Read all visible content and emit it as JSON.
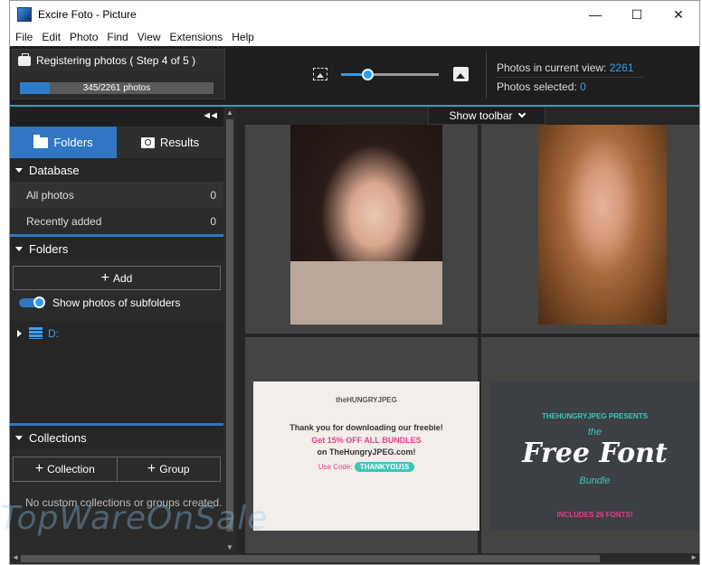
{
  "window": {
    "title": "Excire Foto - Picture",
    "minimize": "—",
    "maximize": "☐",
    "close": "✕"
  },
  "menu": [
    "File",
    "Edit",
    "Photo",
    "Find",
    "View",
    "Extensions",
    "Help"
  ],
  "registration": {
    "label": "Registering photos ( Step 4 of 5 )",
    "progress_text": "345/2261 photos",
    "progress_fraction": 0.1526
  },
  "zoom_slider": {
    "value_fraction": 0.27
  },
  "stats": {
    "in_view_label": "Photos in current view:",
    "in_view_value": "2261",
    "selected_label": "Photos selected:",
    "selected_value": "0"
  },
  "sidebar": {
    "collapse_glyph": "◄◄",
    "tabs": [
      {
        "label": "Folders",
        "active": true
      },
      {
        "label": "Results",
        "active": false
      }
    ],
    "database": {
      "header": "Database",
      "rows": [
        {
          "label": "All photos",
          "count": "0"
        },
        {
          "label": "Recently added",
          "count": "0"
        }
      ]
    },
    "folders": {
      "header": "Folders",
      "add_label": "Add",
      "subfolders_toggle": "Show photos of subfolders",
      "subfolders_on": true,
      "drive": "D:"
    },
    "collections": {
      "header": "Collections",
      "collection_btn": "Collection",
      "group_btn": "Group",
      "empty_note": "No custom collections or groups created."
    }
  },
  "gallery": {
    "toolbar_label": "Show toolbar",
    "promo1": {
      "brand": "theHUNGRYJPEG",
      "line1": "Thank you for downloading our freebie!",
      "line2": "Get 15% OFF ALL BUNDLES",
      "line3": "on TheHungryJPEG.com!",
      "code_label": "Use Code:",
      "code": "THANKYOU15"
    },
    "promo2": {
      "presents": "THEHUNGRYJPEG PRESENTS",
      "the": "the",
      "main": "Free Font",
      "sub": "Bundle",
      "includes": "INCLUDES 26 FONTS!"
    }
  },
  "watermark": "TopWareOnSale",
  "colors": {
    "accent_blue": "#3076c2",
    "link_blue": "#3a9ef0",
    "teal_line": "#38a0b8",
    "promo_pink": "#e2408c",
    "promo_teal": "#3cc6b8"
  }
}
